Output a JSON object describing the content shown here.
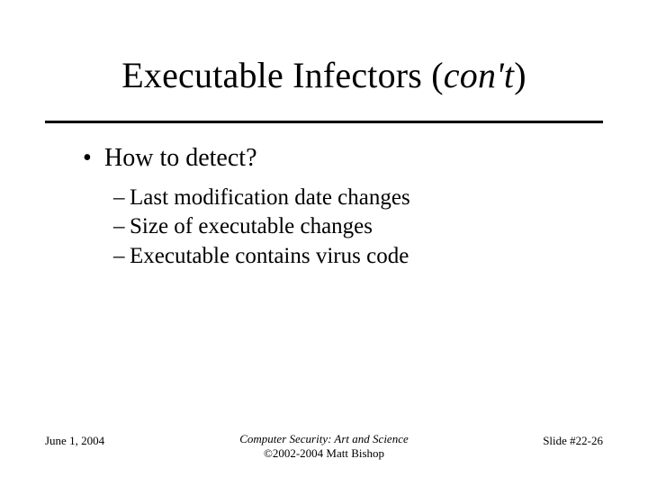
{
  "title": {
    "main": "Executable Infectors (",
    "italic": "con't",
    "tail": ")"
  },
  "body": {
    "bullet1": "How to detect?",
    "subs": {
      "a": "Last modification date changes",
      "b": "Size of executable changes",
      "c": "Executable contains virus code"
    }
  },
  "footer": {
    "date": "June 1, 2004",
    "center_line1": "Computer Security: Art and Science",
    "center_line2": "©2002-2004 Matt Bishop",
    "slidenum": "Slide #22-26"
  }
}
